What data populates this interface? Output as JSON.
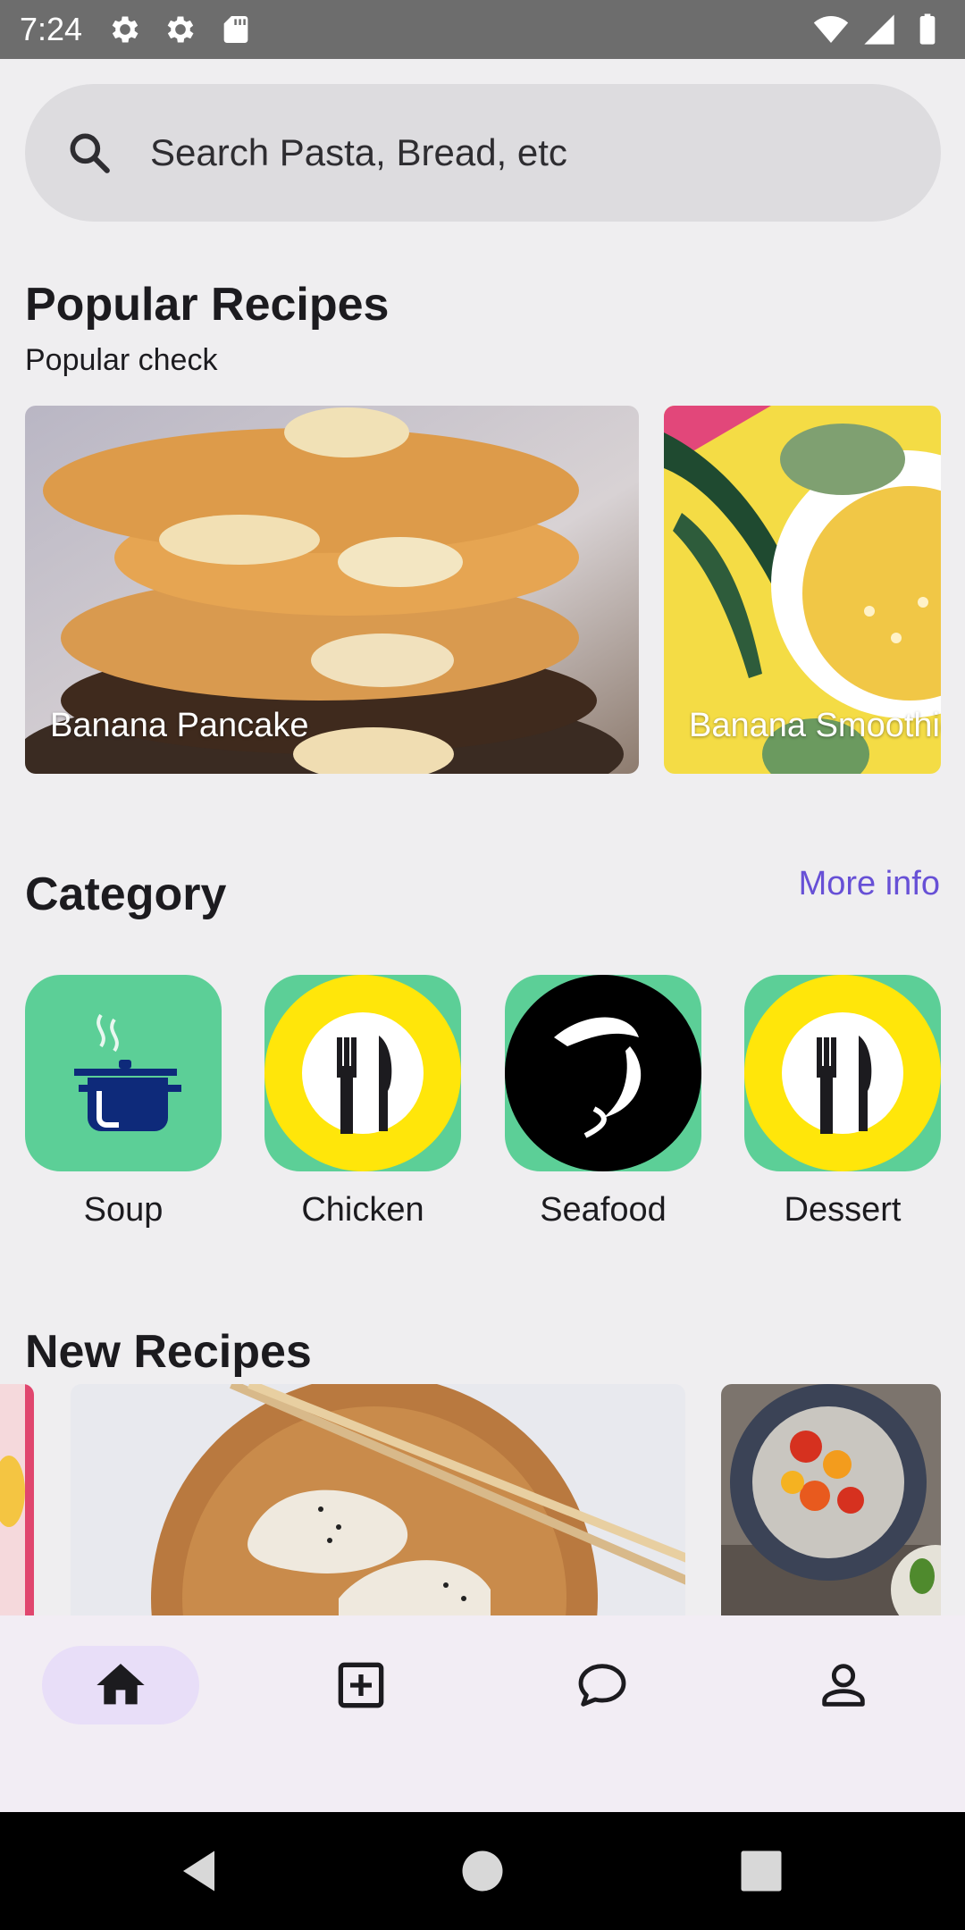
{
  "status_bar": {
    "time": "7:24",
    "left_icons": [
      "gear-icon",
      "gear-icon",
      "sd-card-icon"
    ],
    "right_icons": [
      "wifi-icon",
      "signal-icon",
      "battery-icon"
    ]
  },
  "search": {
    "placeholder": "Search Pasta, Bread, etc",
    "icon": "search-icon"
  },
  "popular": {
    "title": "Popular Recipes",
    "subtitle": "Popular check",
    "cards": [
      {
        "label": "Banana Pancake"
      },
      {
        "label": "Banana Smoothie"
      }
    ]
  },
  "category": {
    "title": "Category",
    "more_label": "More info",
    "items": [
      {
        "label": "Soup",
        "icon": "pot-icon"
      },
      {
        "label": "Chicken",
        "icon": "fork-knife-icon"
      },
      {
        "label": "Seafood",
        "icon": "fish-icon"
      },
      {
        "label": "Dessert",
        "icon": "fork-knife-icon"
      }
    ]
  },
  "new_recipes": {
    "title": "New Recipes"
  },
  "bottom_nav": {
    "items": [
      {
        "icon": "home-icon",
        "active": true
      },
      {
        "icon": "add-box-icon",
        "active": false
      },
      {
        "icon": "chat-bubble-icon",
        "active": false
      },
      {
        "icon": "person-icon",
        "active": false
      }
    ]
  },
  "colors": {
    "accent": "#6750d6",
    "category_tile": "#5ccf97",
    "nav_active": "#e8def8",
    "background": "#efeef0"
  }
}
